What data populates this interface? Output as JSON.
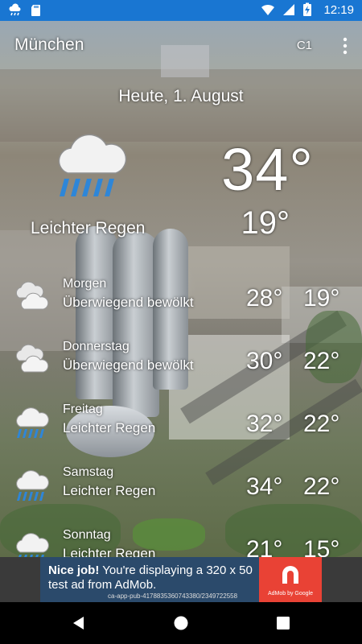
{
  "statusbar": {
    "time": "12:19",
    "icons": [
      "cloud-rain-icon",
      "sd-card-icon",
      "wifi-icon",
      "signal-icon",
      "battery-charging-icon"
    ]
  },
  "appbar": {
    "title": "München",
    "code": "C1",
    "menu_icon": "overflow-menu-icon"
  },
  "current": {
    "date": "Heute, 1. August",
    "high": "34°",
    "low": "19°",
    "condition": "Leichter Regen",
    "icon": "cloud-rain-icon"
  },
  "forecast": [
    {
      "day": "Morgen",
      "condition": "Überwiegend bewölkt",
      "high": "28°",
      "low": "19°",
      "icon": "cloudy-icon"
    },
    {
      "day": "Donnerstag",
      "condition": "Überwiegend bewölkt",
      "high": "30°",
      "low": "22°",
      "icon": "cloudy-icon"
    },
    {
      "day": "Freitag",
      "condition": "Leichter Regen",
      "high": "32°",
      "low": "22°",
      "icon": "cloud-rain-icon"
    },
    {
      "day": "Samstag",
      "condition": "Leichter Regen",
      "high": "34°",
      "low": "22°",
      "icon": "cloud-rain-icon"
    },
    {
      "day": "Sonntag",
      "condition": "Leichter Regen",
      "high": "21°",
      "low": "15°",
      "icon": "cloud-rain-icon"
    }
  ],
  "ad": {
    "headline": "Nice job!",
    "text": "You're displaying a 320 x 50 test ad from AdMob.",
    "id": "ca-app-pub-4178835360743380/2349722558",
    "brand": "AdMob by Google"
  },
  "colors": {
    "statusbar": "#1976d2",
    "ad_background": "#2b4a6b",
    "admob_red": "#e94235",
    "rain_blue": "#2e86d8"
  }
}
